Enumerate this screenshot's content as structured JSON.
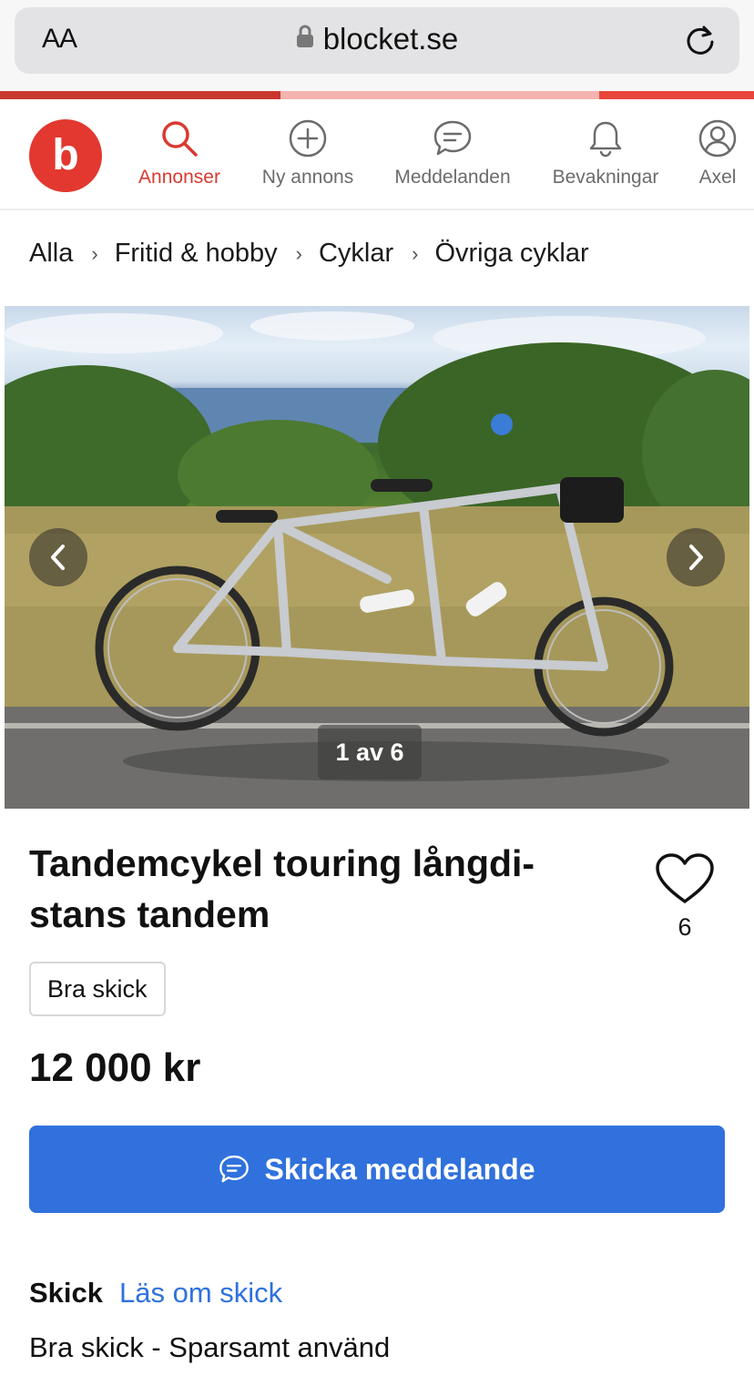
{
  "browser": {
    "text_size_label": "AA",
    "url": "blocket.se"
  },
  "brand": {
    "logo_letter": "b",
    "accent_color": "#e2382f",
    "link_color": "#3071dd"
  },
  "nav": {
    "items": [
      {
        "label": "Annonser",
        "icon": "search-icon",
        "active": true
      },
      {
        "label": "Ny annons",
        "icon": "plus-circle-icon",
        "active": false
      },
      {
        "label": "Meddelanden",
        "icon": "chat-bubble-icon",
        "active": false
      },
      {
        "label": "Bevakningar",
        "icon": "bell-icon",
        "active": false
      },
      {
        "label": "Axel",
        "icon": "user-icon",
        "active": false
      }
    ]
  },
  "breadcrumb": [
    "Alla",
    "Fritid & hobby",
    "Cyklar",
    "Övriga cyklar"
  ],
  "gallery": {
    "counter": "1 av 6"
  },
  "listing": {
    "title": "Tandemcykel touring långdi-stans tandem",
    "favorites_count": "6",
    "condition_badge": "Bra skick",
    "price": "12 000 kr",
    "cta_label": "Skicka meddelande"
  },
  "condition_section": {
    "heading": "Skick",
    "link": "Läs om skick",
    "description": "Bra skick - Sparsamt använd"
  }
}
